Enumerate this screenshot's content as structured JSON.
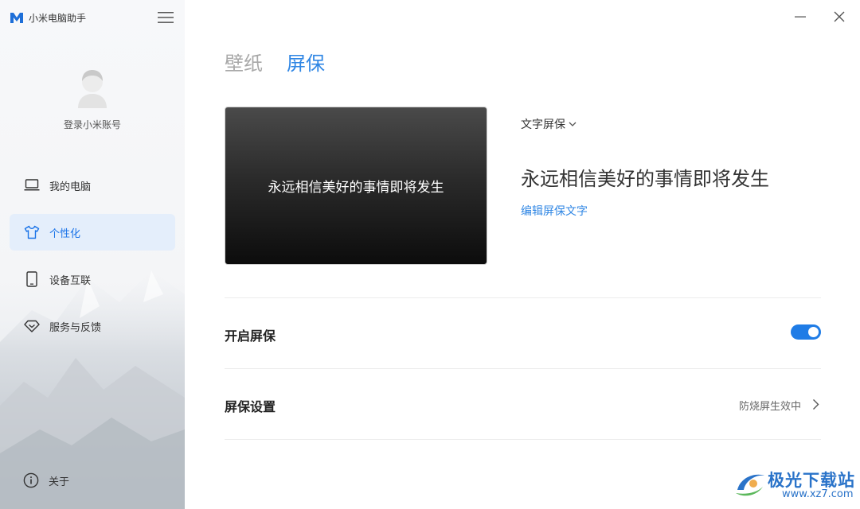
{
  "app": {
    "title": "小米电脑助手"
  },
  "account": {
    "login_label": "登录小米账号"
  },
  "nav": {
    "items": [
      {
        "label": "我的电脑",
        "icon": "laptop-icon",
        "active": false
      },
      {
        "label": "个性化",
        "icon": "tshirt-icon",
        "active": true
      },
      {
        "label": "设备互联",
        "icon": "phone-icon",
        "active": false
      },
      {
        "label": "服务与反馈",
        "icon": "diamond-icon",
        "active": false
      }
    ],
    "about_label": "关于"
  },
  "tabs": [
    {
      "label": "壁纸",
      "active": false
    },
    {
      "label": "屏保",
      "active": true
    }
  ],
  "preview": {
    "text": "永远相信美好的事情即将发生"
  },
  "screensaver": {
    "mode_label": "文字屏保",
    "text": "永远相信美好的事情即将发生",
    "edit_label": "编辑屏保文字"
  },
  "rows": {
    "enable_label": "开启屏保",
    "enable_on": true,
    "settings_label": "屏保设置",
    "settings_value": "防烧屏生效中"
  },
  "watermark": {
    "title": "极光下载站",
    "url": "www.xz7.com"
  },
  "colors": {
    "accent": "#2f86e4",
    "toggle": "#1f7ce6",
    "active_bg": "#e4eefb"
  }
}
